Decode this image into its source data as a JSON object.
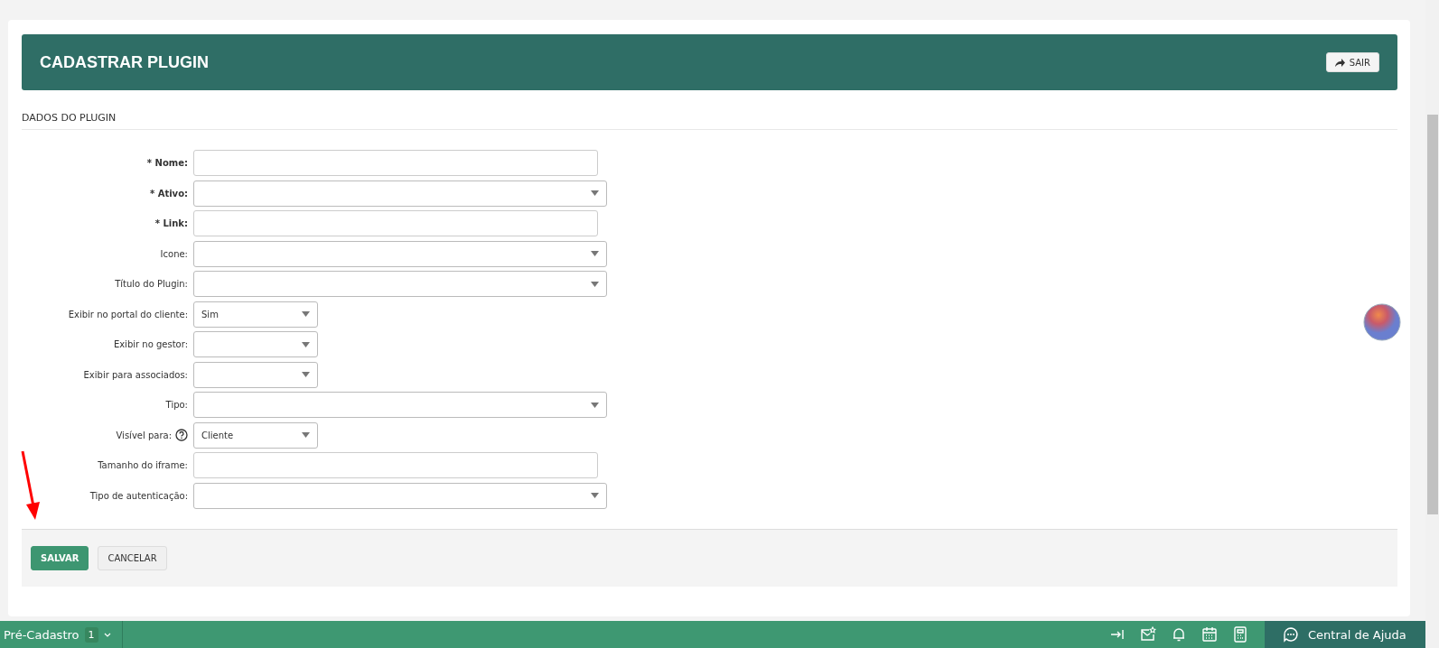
{
  "header": {
    "title": "CADASTRAR PLUGIN",
    "exit_button": "SAIR"
  },
  "section": {
    "title": "DADOS DO PLUGIN"
  },
  "fields": [
    {
      "label": "* Nome:",
      "required": true,
      "kind": "text",
      "wide": true,
      "help": false
    },
    {
      "label": "* Ativo:",
      "required": true,
      "kind": "select",
      "wide": true,
      "help": false
    },
    {
      "label": "* Link:",
      "required": true,
      "kind": "text",
      "wide": true,
      "help": false
    },
    {
      "label": "Icone:",
      "required": false,
      "kind": "select",
      "wide": true,
      "help": false
    },
    {
      "label": "Título do Plugin:",
      "required": false,
      "kind": "select",
      "wide": true,
      "help": false
    },
    {
      "label": "Exibir no portal do cliente:",
      "required": false,
      "kind": "select",
      "wide": false,
      "value": "Sim",
      "help": false
    },
    {
      "label": "Exibir no gestor:",
      "required": false,
      "kind": "select",
      "wide": false,
      "help": false
    },
    {
      "label": "Exibir para associados:",
      "required": false,
      "kind": "select",
      "wide": false,
      "help": false
    },
    {
      "label": "Tipo:",
      "required": false,
      "kind": "select",
      "wide": true,
      "help": false
    },
    {
      "label": "Visível para:",
      "required": false,
      "kind": "select",
      "wide": false,
      "value": "Cliente",
      "help": true
    },
    {
      "label": "Tamanho do iframe:",
      "required": false,
      "kind": "text",
      "wide": true,
      "help": false
    },
    {
      "label": "Tipo de autenticação:",
      "required": false,
      "kind": "select",
      "wide": true,
      "help": false
    }
  ],
  "actions": [
    {
      "label": "SALVAR",
      "kind": "primary"
    },
    {
      "label": "CANCELAR",
      "kind": "secondary"
    }
  ],
  "bottom_bar": {
    "menu": "Pré-Cadastro",
    "count": "1",
    "help": "Central de Ajuda"
  }
}
